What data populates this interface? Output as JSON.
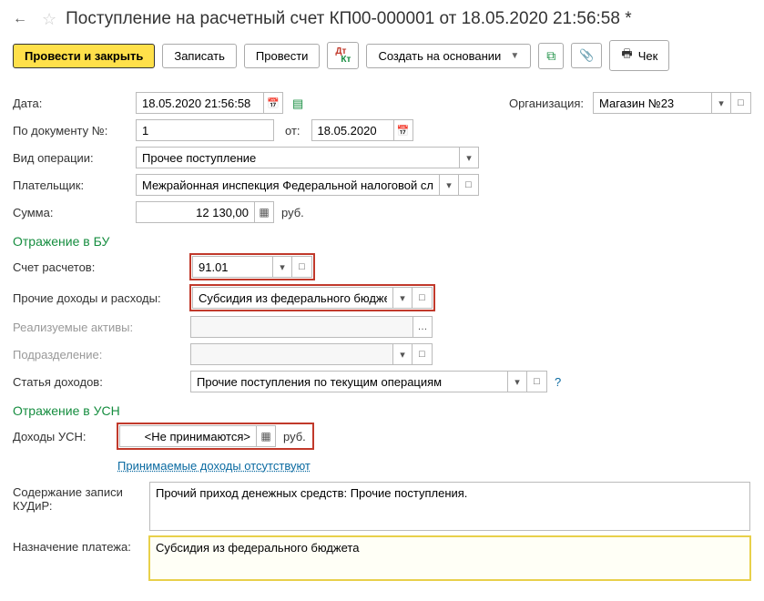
{
  "header": {
    "title": "Поступление на расчетный счет КП00-000001 от 18.05.2020 21:56:58 *"
  },
  "toolbar": {
    "post_close": "Провести и закрыть",
    "save": "Записать",
    "post": "Провести",
    "create_based": "Создать на основании",
    "receipt": "Чек"
  },
  "fields": {
    "date_label": "Дата:",
    "date_value": "18.05.2020 21:56:58",
    "org_label": "Организация:",
    "org_value": "Магазин №23",
    "docnum_label": "По документу №:",
    "docnum_value": "1",
    "docnum_from": "от:",
    "docnum_date": "18.05.2020",
    "op_type_label": "Вид операции:",
    "op_type_value": "Прочее поступление",
    "payer_label": "Плательщик:",
    "payer_value": "Межрайонная инспекция Федеральной налоговой службы",
    "amount_label": "Сумма:",
    "amount_value": "12 130,00",
    "currency": "руб."
  },
  "bu": {
    "section": "Отражение в БУ",
    "account_label": "Счет расчетов:",
    "account_value": "91.01",
    "income_exp_label": "Прочие доходы и расходы:",
    "income_exp_value": "Субсидия из федерального бюджета",
    "assets_label": "Реализуемые активы:",
    "assets_value": "",
    "division_label": "Подразделение:",
    "division_value": "",
    "income_item_label": "Статья доходов:",
    "income_item_value": "Прочие поступления по текущим операциям"
  },
  "usn": {
    "section": "Отражение в УСН",
    "income_label": "Доходы УСН:",
    "income_value": "<Не принимаются>",
    "currency": "руб.",
    "note": "Принимаемые доходы отсутствуют",
    "kudir_label": "Содержание записи КУДиР:",
    "kudir_value": "Прочий приход денежных средств: Прочие поступления.",
    "purpose_label": "Назначение платежа:",
    "purpose_value": "Субсидия из федерального бюджета"
  }
}
